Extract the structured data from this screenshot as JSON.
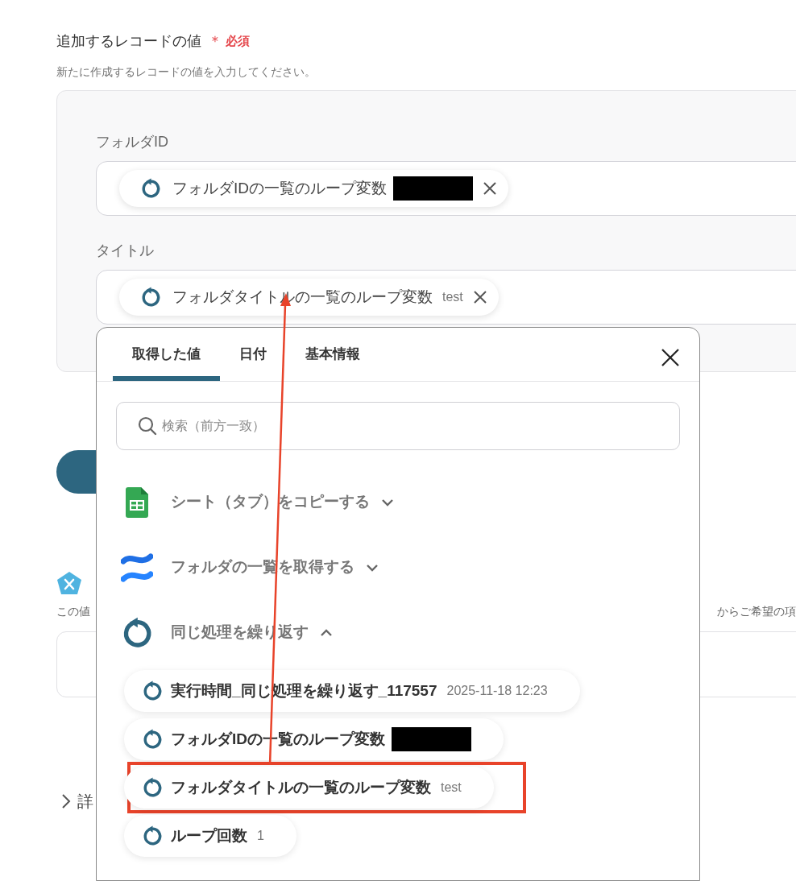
{
  "section": {
    "title": "追加するレコードの値",
    "required_mark": "＊",
    "required_label": "必須",
    "description": "新たに作成するレコードの値を入力してください。"
  },
  "fields": [
    {
      "label": "フォルダID",
      "chip": {
        "label": "フォルダIDの一覧のループ変数",
        "redacted": true
      }
    },
    {
      "label": "タイトル",
      "chip": {
        "label": "フォルダタイトルの一覧のループ変数",
        "redacted": false,
        "value": "test"
      }
    }
  ],
  "background": {
    "note_left": "この値",
    "note_right": "からご希望の項",
    "details_partial": "詳"
  },
  "picker": {
    "tabs": [
      {
        "label": "取得した値",
        "selected": true
      },
      {
        "label": "日付",
        "selected": false
      },
      {
        "label": "基本情報",
        "selected": false
      }
    ],
    "search_placeholder": "検索（前方一致）",
    "groups": [
      {
        "kind": "sheets",
        "title": "シート（タブ）をコピーする",
        "expanded": false
      },
      {
        "kind": "confluence",
        "title": "フォルダの一覧を取得する",
        "expanded": false
      },
      {
        "kind": "loop",
        "title": "同じ処理を繰り返す",
        "expanded": true,
        "items": [
          {
            "label": "実行時間_同じ処理を繰り返す_117557",
            "value": "2025-11-18 12:23",
            "redacted": false,
            "highlighted": false
          },
          {
            "label": "フォルダIDの一覧のループ変数",
            "redacted": true,
            "highlighted": false
          },
          {
            "label": "フォルダタイトルの一覧のループ変数",
            "value": "test",
            "redacted": false,
            "highlighted": true
          },
          {
            "label": "ループ回数",
            "value": "1",
            "redacted": false,
            "highlighted": false
          }
        ]
      }
    ]
  }
}
